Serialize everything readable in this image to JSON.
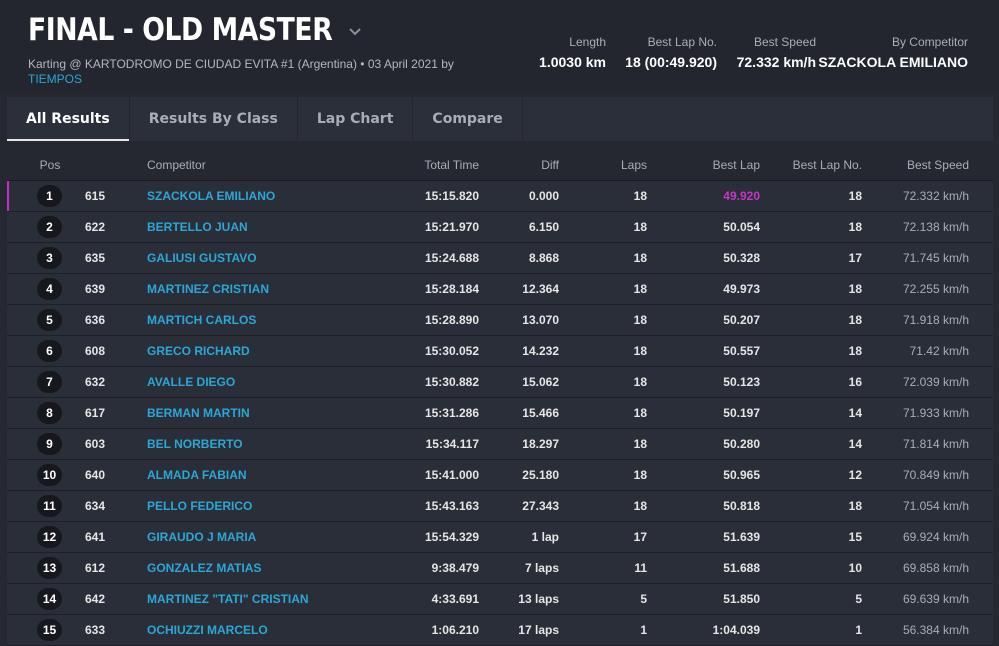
{
  "header": {
    "title": "FINAL - OLD MASTER",
    "subtitle": "Karting @ KARTODROMO DE CIUDAD EVITA #1 (Argentina) • 03 April 2021 by",
    "timing_link": "TIEMPOS",
    "stats": [
      {
        "label": "Length",
        "value": "1.0030 km"
      },
      {
        "label": "Best Lap No.",
        "value": "18 (00:49.920)"
      },
      {
        "label": "Best Speed",
        "value": "72.332 km/h"
      },
      {
        "label": "By Competitor",
        "value": "SZACKOLA EMILIANO"
      }
    ]
  },
  "tabs": [
    "All Results",
    "Results By Class",
    "Lap Chart",
    "Compare"
  ],
  "active_tab": "All Results",
  "columns": {
    "pos": "Pos",
    "competitor": "Competitor",
    "total_time": "Total Time",
    "diff": "Diff",
    "laps": "Laps",
    "best_lap": "Best Lap",
    "best_lap_no": "Best Lap No.",
    "best_speed": "Best Speed"
  },
  "rows": [
    {
      "pos": "1",
      "num": "615",
      "name": "SZACKOLA EMILIANO",
      "total": "15:15.820",
      "diff": "0.000",
      "laps": "18",
      "best": "49.920",
      "bln": "18",
      "speed": "72.332 km/h"
    },
    {
      "pos": "2",
      "num": "622",
      "name": "BERTELLO JUAN",
      "total": "15:21.970",
      "diff": "6.150",
      "laps": "18",
      "best": "50.054",
      "bln": "18",
      "speed": "72.138 km/h"
    },
    {
      "pos": "3",
      "num": "635",
      "name": "GALIUSI GUSTAVO",
      "total": "15:24.688",
      "diff": "8.868",
      "laps": "18",
      "best": "50.328",
      "bln": "17",
      "speed": "71.745 km/h"
    },
    {
      "pos": "4",
      "num": "639",
      "name": "MARTINEZ CRISTIAN",
      "total": "15:28.184",
      "diff": "12.364",
      "laps": "18",
      "best": "49.973",
      "bln": "18",
      "speed": "72.255 km/h"
    },
    {
      "pos": "5",
      "num": "636",
      "name": "MARTICH CARLOS",
      "total": "15:28.890",
      "diff": "13.070",
      "laps": "18",
      "best": "50.207",
      "bln": "18",
      "speed": "71.918 km/h"
    },
    {
      "pos": "6",
      "num": "608",
      "name": "GRECO RICHARD",
      "total": "15:30.052",
      "diff": "14.232",
      "laps": "18",
      "best": "50.557",
      "bln": "18",
      "speed": "71.42 km/h"
    },
    {
      "pos": "7",
      "num": "632",
      "name": "AVALLE DIEGO",
      "total": "15:30.882",
      "diff": "15.062",
      "laps": "18",
      "best": "50.123",
      "bln": "16",
      "speed": "72.039 km/h"
    },
    {
      "pos": "8",
      "num": "617",
      "name": "BERMAN MARTIN",
      "total": "15:31.286",
      "diff": "15.466",
      "laps": "18",
      "best": "50.197",
      "bln": "14",
      "speed": "71.933 km/h"
    },
    {
      "pos": "9",
      "num": "603",
      "name": "BEL NORBERTO",
      "total": "15:34.117",
      "diff": "18.297",
      "laps": "18",
      "best": "50.280",
      "bln": "14",
      "speed": "71.814 km/h"
    },
    {
      "pos": "10",
      "num": "640",
      "name": "ALMADA FABIAN",
      "total": "15:41.000",
      "diff": "25.180",
      "laps": "18",
      "best": "50.965",
      "bln": "12",
      "speed": "70.849 km/h"
    },
    {
      "pos": "11",
      "num": "634",
      "name": "PELLO FEDERICO",
      "total": "15:43.163",
      "diff": "27.343",
      "laps": "18",
      "best": "50.818",
      "bln": "18",
      "speed": "71.054 km/h"
    },
    {
      "pos": "12",
      "num": "641",
      "name": "GIRAUDO J MARIA",
      "total": "15:54.329",
      "diff": "1 lap",
      "laps": "17",
      "best": "51.639",
      "bln": "15",
      "speed": "69.924 km/h"
    },
    {
      "pos": "13",
      "num": "612",
      "name": "GONZALEZ MATIAS",
      "total": "9:38.479",
      "diff": "7 laps",
      "laps": "11",
      "best": "51.688",
      "bln": "10",
      "speed": "69.858 km/h"
    },
    {
      "pos": "14",
      "num": "642",
      "name": "MARTINEZ \"TATI\" CRISTIAN",
      "total": "4:33.691",
      "diff": "13 laps",
      "laps": "5",
      "best": "51.850",
      "bln": "5",
      "speed": "69.639 km/h"
    },
    {
      "pos": "15",
      "num": "633",
      "name": "OCHIUZZI MARCELO",
      "total": "1:06.210",
      "diff": "17 laps",
      "laps": "1",
      "best": "1:04.039",
      "bln": "1",
      "speed": "56.384 km/h"
    }
  ],
  "colors": {
    "accent_link": "#2aa7d6",
    "fastest_lap": "#c436c8",
    "background": "#252831"
  },
  "icons": {
    "title_dropdown": "chevron-down-icon"
  }
}
